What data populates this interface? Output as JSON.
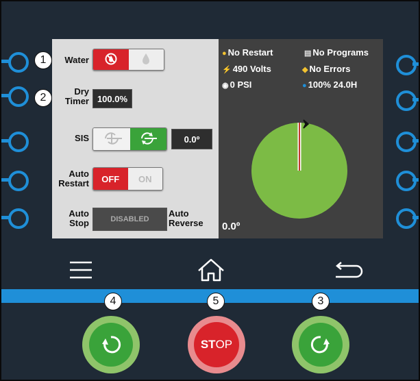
{
  "markers": [
    "1",
    "2",
    "3",
    "4",
    "5"
  ],
  "controls": {
    "water": {
      "label": "Water"
    },
    "dry_timer": {
      "label_line1": "Dry",
      "label_line2": "Timer",
      "value": "100.0%"
    },
    "sis": {
      "label": "SIS",
      "value": "0.0º"
    },
    "auto_restart": {
      "label_line1": "Auto",
      "label_line2": "Restart",
      "off_label": "OFF",
      "on_label": "ON"
    },
    "auto_stop": {
      "label_line1": "Auto",
      "label_line2": "Stop",
      "value": "DISABLED"
    },
    "auto_reverse": {
      "label_line1": "Auto",
      "label_line2": "Reverse"
    }
  },
  "status": {
    "restart": "No Restart",
    "programs": "No Programs",
    "voltage": "490 Volts",
    "errors": "No Errors",
    "pressure": "0 PSI",
    "percent_timer": "100% 24.0H",
    "angle": "0.0º"
  },
  "buttons": {
    "stop_label_bold": "ST",
    "stop_label_rest": "OP"
  },
  "colors": {
    "accent_blue": "#1f8fd8",
    "pie_green": "#7cbb45",
    "red_toggle": "#d8232a",
    "green_toggle": "#3aa33a",
    "stop_red": "#d8232a"
  }
}
